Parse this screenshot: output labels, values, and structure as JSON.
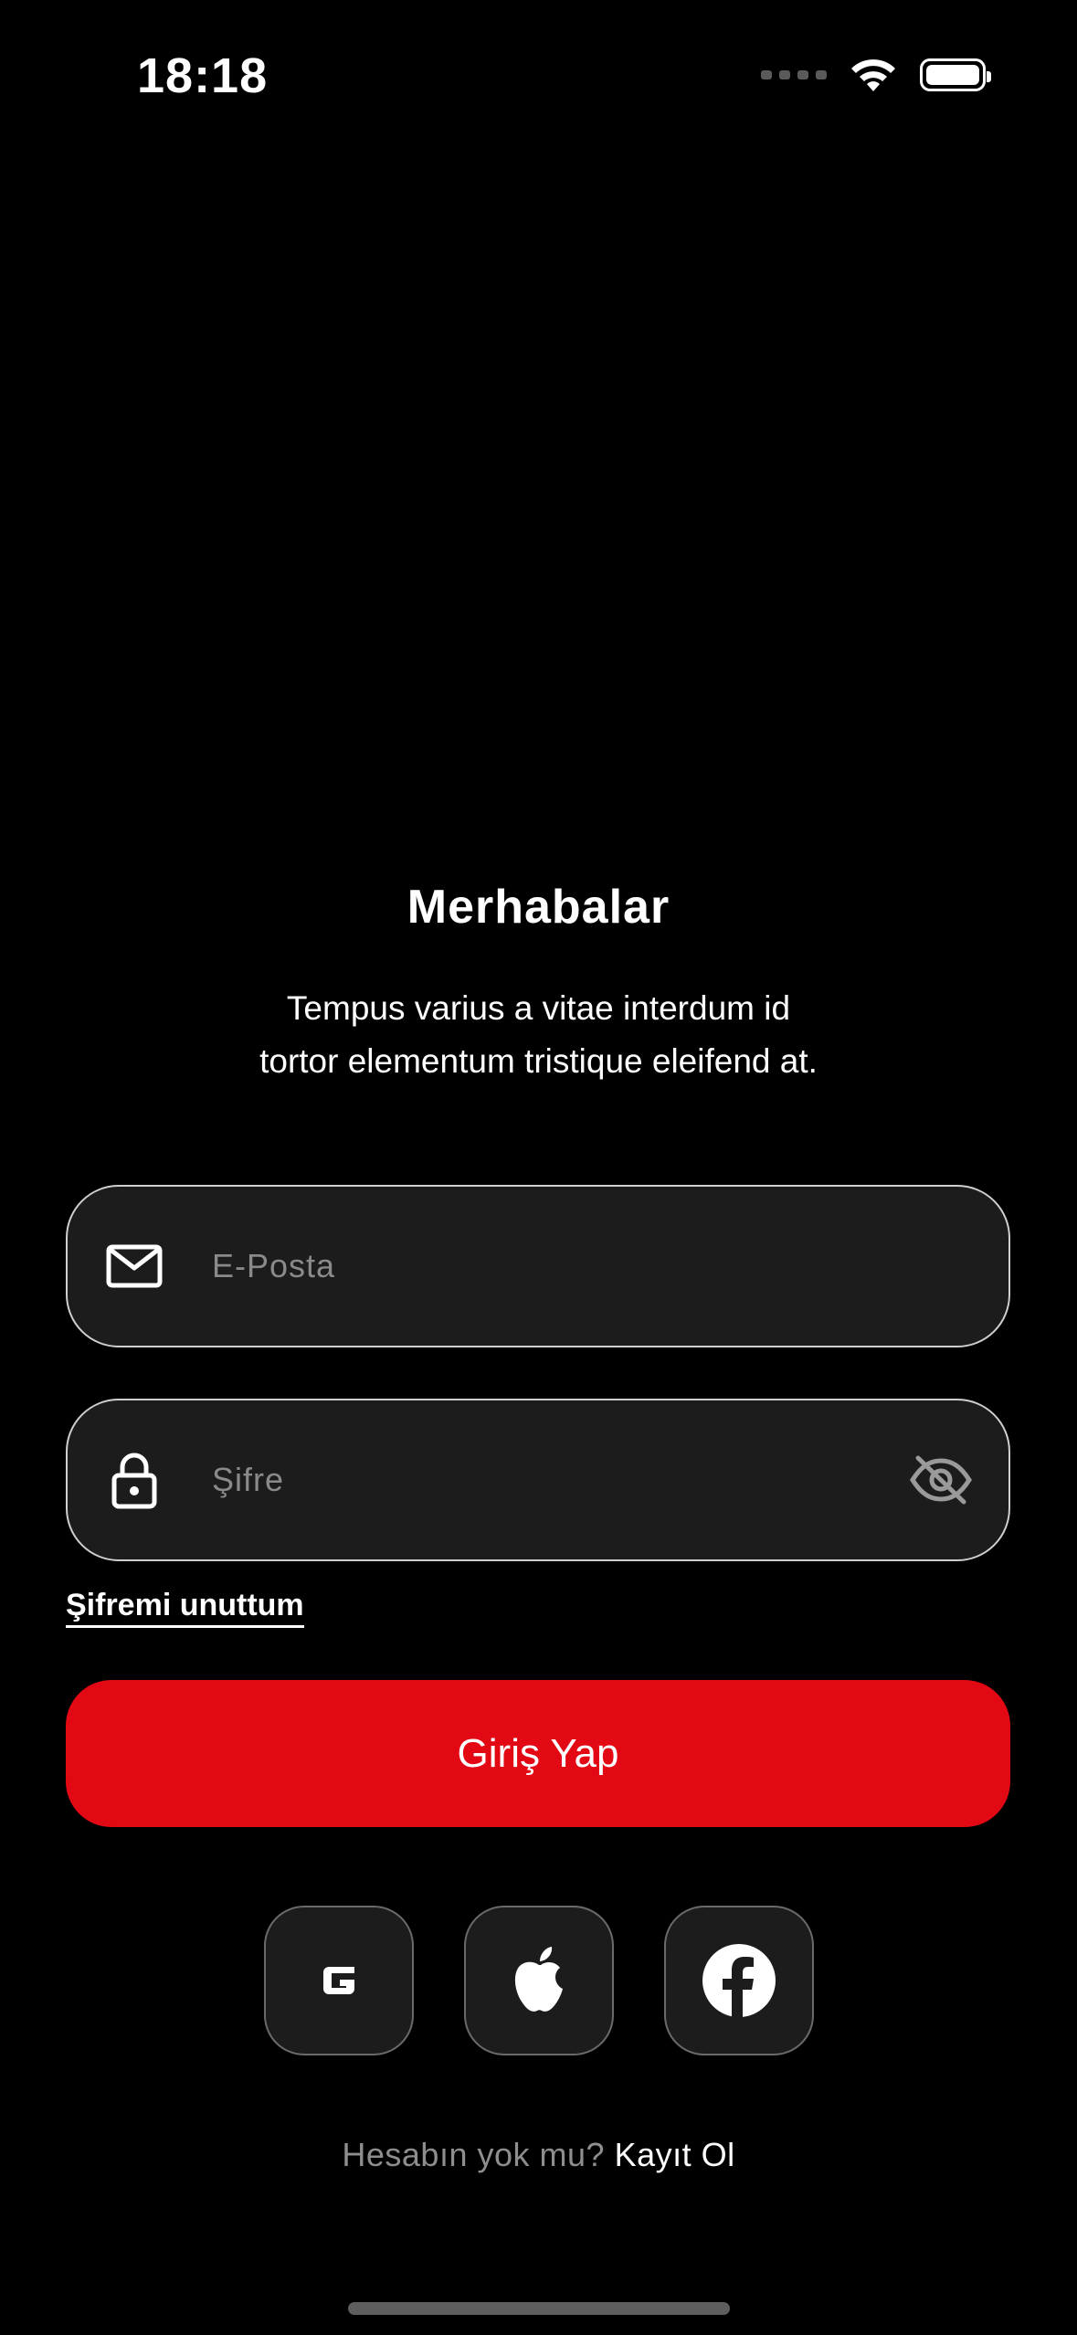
{
  "status_bar": {
    "time": "18:18",
    "icons": [
      "cellular-signal-icon",
      "wifi-icon",
      "battery-icon"
    ]
  },
  "header": {
    "title": "Merhabalar",
    "subtitle_line1": "Tempus varius a vitae interdum id",
    "subtitle_line2": "tortor elementum tristique eleifend at."
  },
  "form": {
    "email_placeholder": "E-Posta",
    "email_value": "",
    "email_icon": "mail-icon",
    "password_placeholder": "Şifre",
    "password_value": "",
    "password_icon": "lock-icon",
    "password_toggle_icon": "eye-off-icon",
    "forgot_label": "Şifremi unuttum",
    "submit_label": "Giriş Yap"
  },
  "social": {
    "items": [
      {
        "name": "google",
        "icon": "google-icon"
      },
      {
        "name": "apple",
        "icon": "apple-icon"
      },
      {
        "name": "facebook",
        "icon": "facebook-icon"
      }
    ]
  },
  "footer": {
    "question": "Hesabın yok mu?",
    "signup_label": "Kayıt Ol"
  },
  "colors": {
    "background": "#000000",
    "accent": "#e30914",
    "field_bg": "#1c1c1c",
    "placeholder": "#8a8a8a"
  }
}
